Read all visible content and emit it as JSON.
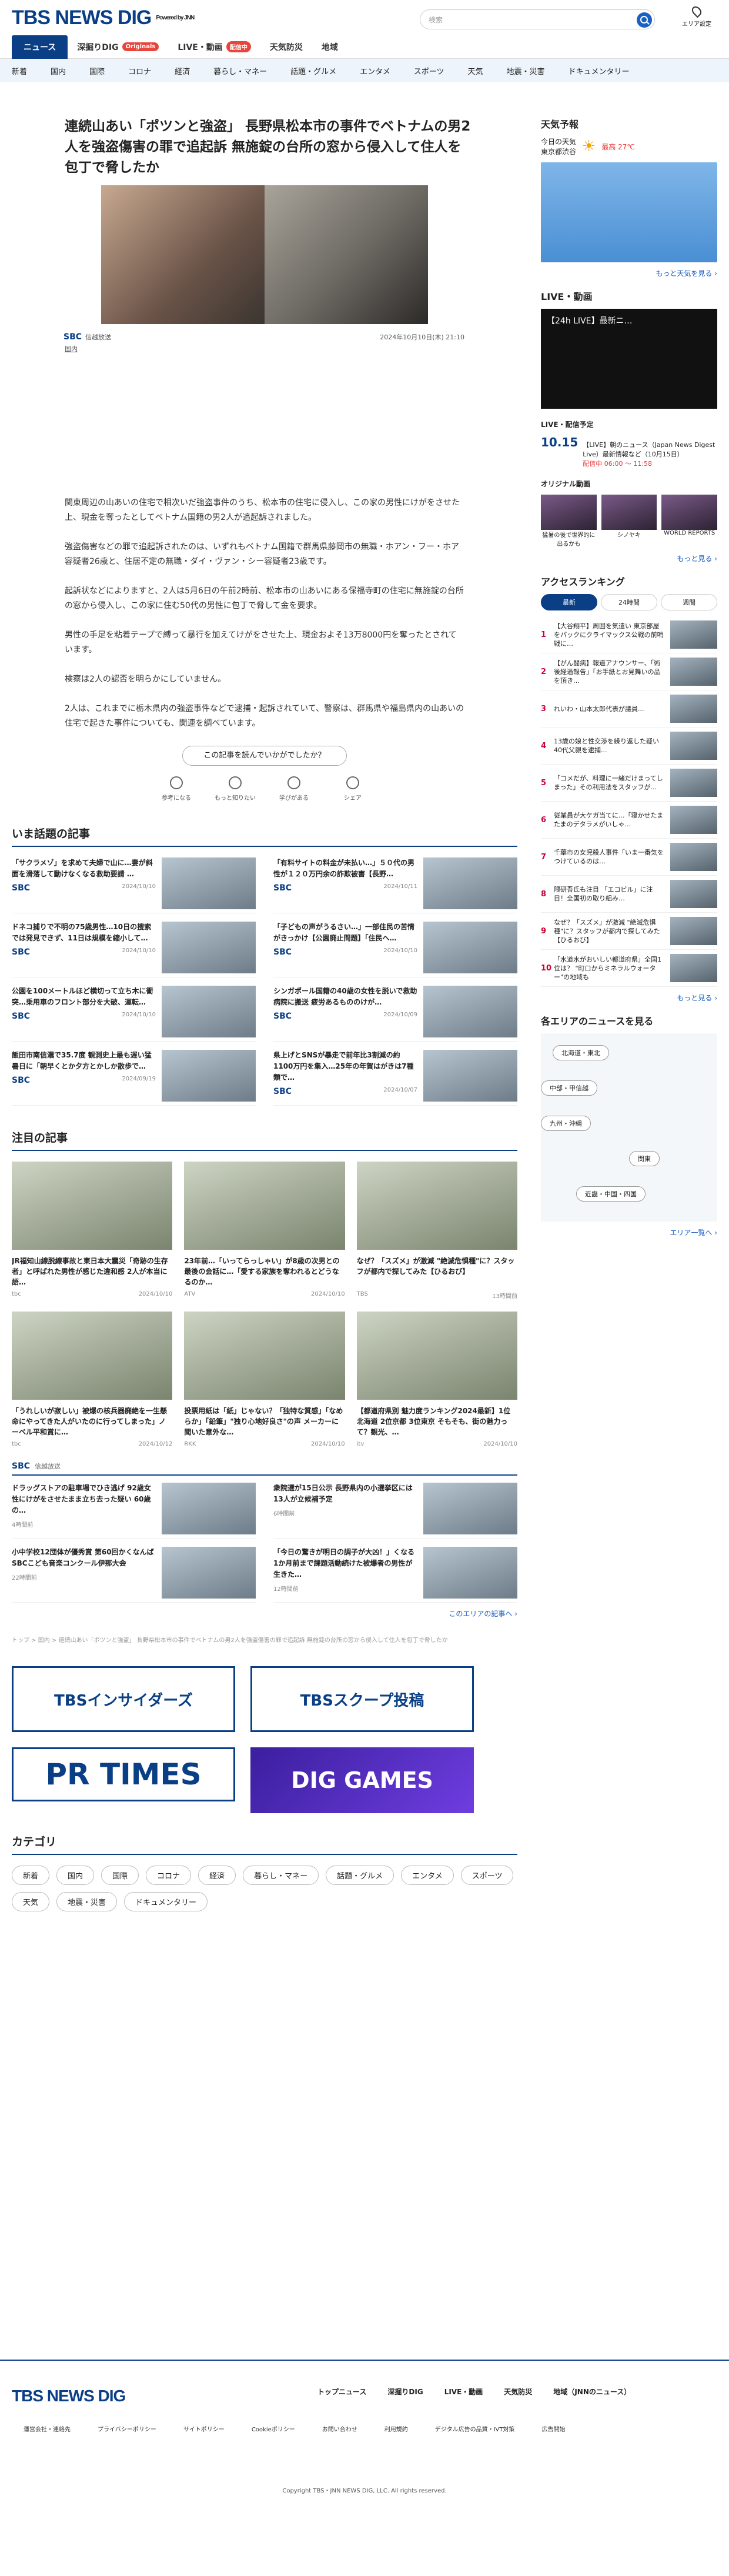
{
  "header": {
    "logo": "TBS NEWS DIG",
    "powered": "Powered by JNN",
    "search_placeholder": "検索",
    "area": "エリア設定"
  },
  "nav1": [
    {
      "label": "ニュース",
      "on": true
    },
    {
      "label": "深掘りDIG",
      "badge": "Originals"
    },
    {
      "label": "LIVE・動画",
      "badge": "配信中"
    },
    {
      "label": "天気防災"
    },
    {
      "label": "地域"
    }
  ],
  "nav2": [
    "新着",
    "国内",
    "国際",
    "コロナ",
    "経済",
    "暮らし・マネー",
    "話題・グルメ",
    "エンタメ",
    "スポーツ",
    "天気",
    "地震・災害",
    "ドキュメンタリー"
  ],
  "article": {
    "title": "連続山あい「ポツンと強盗」 長野県松本市の事件でベトナムの男2人を強盗傷害の罪で追起訴 無施錠の台所の窓から侵入して住人を包丁で脅したか",
    "source": "信越放送",
    "source_logo": "SBC",
    "date": "2024年10月10日(木) 21:10",
    "category": "国内",
    "paragraphs": [
      "関東周辺の山あいの住宅で相次いだ強盗事件のうち、松本市の住宅に侵入し、この家の男性にけがをさせた上、現金を奪ったとしてベトナム国籍の男2人が追起訴されました。",
      "強盗傷害などの罪で追起訴されたのは、いずれもベトナム国籍で群馬県藤岡市の無職・ホアン・フー・ホア容疑者26歳と、住居不定の無職・ダイ・ヴァン・シー容疑者23歳です。",
      "起訴状などによりますと、2人は5月6日の午前2時前、松本市の山あいにある保福寺町の住宅に無施錠の台所の窓から侵入し、この家に住む50代の男性に包丁で脅して金を要求。",
      "男性の手足を粘着テープで縛って暴行を加えてけがをさせた上、現金およそ13万8000円を奪ったとされています。",
      "検察は2人の認否を明らかにしていません。",
      "2人は、これまでに栃木県内の強盗事件などで逮捕・起訴されていて、警察は、群馬県や福島県内の山あいの住宅で起きた事件についても、関連を調べています。"
    ],
    "question": "この記事を読んでいかがでしたか？",
    "reactions": [
      "参考になる",
      "もっと知りたい",
      "学びがある",
      "シェア"
    ]
  },
  "topics": {
    "heading": "いま話題の記事",
    "items": [
      {
        "t": "「サクラメゾ」を求めて夫婦で山に…妻が斜面を滑落して動けなくなる救助要請 …",
        "d": "2024/10/10",
        "s": "SBC"
      },
      {
        "t": "「有料サイトの料金が未払い…」５０代の男性が１２０万円余の詐欺被害【長野…",
        "d": "2024/10/11",
        "s": "SBC"
      },
      {
        "t": "ドネコ捕りで不明の75歳男性…10日の捜索では発見できず、11日は規模を縮小して…",
        "d": "2024/10/10",
        "s": "SBC"
      },
      {
        "t": "「子どもの声がうるさい…」一部住民の苦情がきっかけ【公園廃止問題】「住民へ…",
        "d": "2024/10/10",
        "s": "SBC"
      },
      {
        "t": "公園を100メートルほど横切って立ち木に衝突…乗用車のフロント部分を大破、運転…",
        "d": "2024/10/10",
        "s": "SBC"
      },
      {
        "t": "シンガポール国籍の40歳の女性を脱いで救助 病院に搬送 疲労あるもののけが…",
        "d": "2024/10/09",
        "s": "SBC"
      },
      {
        "t": "飯田市南信濃で35.7度 観測史上最も遅い猛暑日に「朝早くとか夕方とかしか散歩で…",
        "d": "2024/09/19",
        "s": "SBC"
      },
      {
        "t": "県上げとSNSが暴走で前年比3割減の約1100万円を集入…25年の年賀はがきは7種類で…",
        "d": "2024/10/07",
        "s": "SBC"
      }
    ]
  },
  "featured": {
    "heading": "注目の記事",
    "items": [
      {
        "t": "JR福知山線脱線事故と東日本大震災「奇跡の生存者」と呼ばれた男性が感じた違和感 2人が本当に語…",
        "d": "2024/10/10",
        "s": "tbc"
      },
      {
        "t": "23年前…「いってらっしゃい」が8歳の次男との最後の会話に…「愛する家族を奪われるとどうなるのか…",
        "d": "2024/10/10",
        "s": "ATV"
      },
      {
        "t": "なぜ？「スズメ」が激減 \"絶滅危惧種\"に？スタッフが都内で探してみた【ひるおび】",
        "d": "13時間前",
        "s": "TBS"
      },
      {
        "t": "「うれしいが寂しい」被爆の核兵器廃絶を一生懸命にやってきた人がいたのに行ってしまった」ノーベル平和賞に…",
        "d": "2024/10/12",
        "s": "tbc"
      },
      {
        "t": "投票用紙は「紙」じゃない？「独特な質感」「なめらか」「鉛筆」\"独り心地好良さ\"の声 メーカーに聞いた意外な…",
        "d": "2024/10/10",
        "s": "RKK"
      },
      {
        "t": "【都道府県別 魅力度ランキング2024最新】1位北海道 2位京都 3位東京 そもそも、街の魅力って？観光、…",
        "d": "2024/10/10",
        "s": "itv"
      }
    ]
  },
  "sbc": {
    "heading": "信越放送",
    "items": [
      {
        "t": "ドラッグストアの駐車場でひき逃げ 92歳女性にけがをさせたまま立ち去った疑い 60歳の…",
        "d": "4時間前"
      },
      {
        "t": "衆院選が15日公示 長野県内の小選挙区には13人が立候補予定",
        "d": "6時間前"
      },
      {
        "t": "小中学校12団体が優秀賞 第60回かくなんばSBCこども音楽コンクール伊那大会",
        "d": "22時間前"
      },
      {
        "t": "「今日の驚きが明日の調子が大凶！」くなる1か月前まで課題活動続けた被爆者の男性が生きた…",
        "d": "12時間前"
      }
    ],
    "more": "このエリアの記事へ ›"
  },
  "breadcrumb": "トップ > 国内 > 連続山あい「ポツンと強盗」 長野県松本市の事件でベトナムの男2人を強盗傷害の罪で追起訴 無施錠の台所の窓から侵入して住人を包丁で脅したか",
  "banners": [
    "TBSインサイダーズ",
    "TBSスクープ投稿",
    "PR TIMES",
    "DIG GAMES"
  ],
  "category_block": {
    "heading": "カテゴリ",
    "items": [
      "新着",
      "国内",
      "国際",
      "コロナ",
      "経済",
      "暮らし・マネー",
      "話題・グルメ",
      "エンタメ",
      "スポーツ",
      "天気",
      "地震・災害",
      "ドキュメンタリー"
    ]
  },
  "sidebar": {
    "weather": {
      "heading": "天気予報",
      "today": "今日の天気",
      "place": "東京都渋谷",
      "hi": "最高 27℃",
      "more": "もっと天気を見る ›"
    },
    "live": {
      "heading": "LIVE・動画",
      "video_title": "【24h LIVE】最新ニ…",
      "schedule_heading": "LIVE・配信予定",
      "time": "10.15",
      "show": "【LIVE】朝のニュース（Japan News Digest Live）最新情報など（10月15日）",
      "onair": "配信中 06:00 ～ 11:58",
      "orig_heading": "オリジナル動画",
      "orig": [
        "猛暑の後で世界的に出るかも",
        "シノヤキ",
        "WORLD REPORTS"
      ],
      "more": "もっと見る ›"
    },
    "rank": {
      "heading": "アクセスランキング",
      "tabs": [
        "最新",
        "24時間",
        "週間"
      ],
      "items": [
        "【大谷翔平】周囲を気遣い 東京部屋をパックにクライマックス公戦の前哨戦に…",
        "【がん闘病】報道アナウンサー、「術後経過報告」「お手紙とお見舞いの品を頂き…",
        "れいわ・山本太郎代表が議員...",
        "13歳の娘と性交渉を繰り返した疑い 40代父親を逮捕...",
        "「コメだが、料理に一緒だけまってしまった」その利用法をスタッフが...",
        "従業員が大ケガ当てに...「寝かせたまたまのデタラメがいしゃ…",
        "千葉市の女児殺人事件「いま一番気をつけているのは…",
        "隈研吾氏も注目 「エコビル」に注目！全国初の取り組み…",
        "なぜ？「スズメ」が激減 \"絶滅危惧種\"に？スタッフが都内で探してみた【ひるおび】",
        "「水道水がおいしい都道府県」全国1位は？ \"町口からミネラルウォーター\"の地域も"
      ],
      "more": "もっと見る ›"
    },
    "areas": {
      "heading": "各エリアのニュースを見る",
      "pills": [
        "北海道・東北",
        "中部・甲信越",
        "九州・沖縄",
        "関東",
        "近畿・中国・四国"
      ],
      "more": "エリア一覧へ ›"
    }
  },
  "footer": {
    "logo": "TBS NEWS DIG",
    "nav": [
      "トップニュース",
      "深掘りDIG",
      "LIVE・動画",
      "天気防災",
      "地域（JNNのニュース）"
    ],
    "links": [
      "運営会社・連絡先",
      "プライバシーポリシー",
      "サイトポリシー",
      "Cookieポリシー",
      "お問い合わせ",
      "利用規約",
      "デジタル広告の品質・IVT対策",
      "広告開始"
    ],
    "copyright": "Copyright TBS・JNN NEWS DIG, LLC. All rights reserved."
  }
}
